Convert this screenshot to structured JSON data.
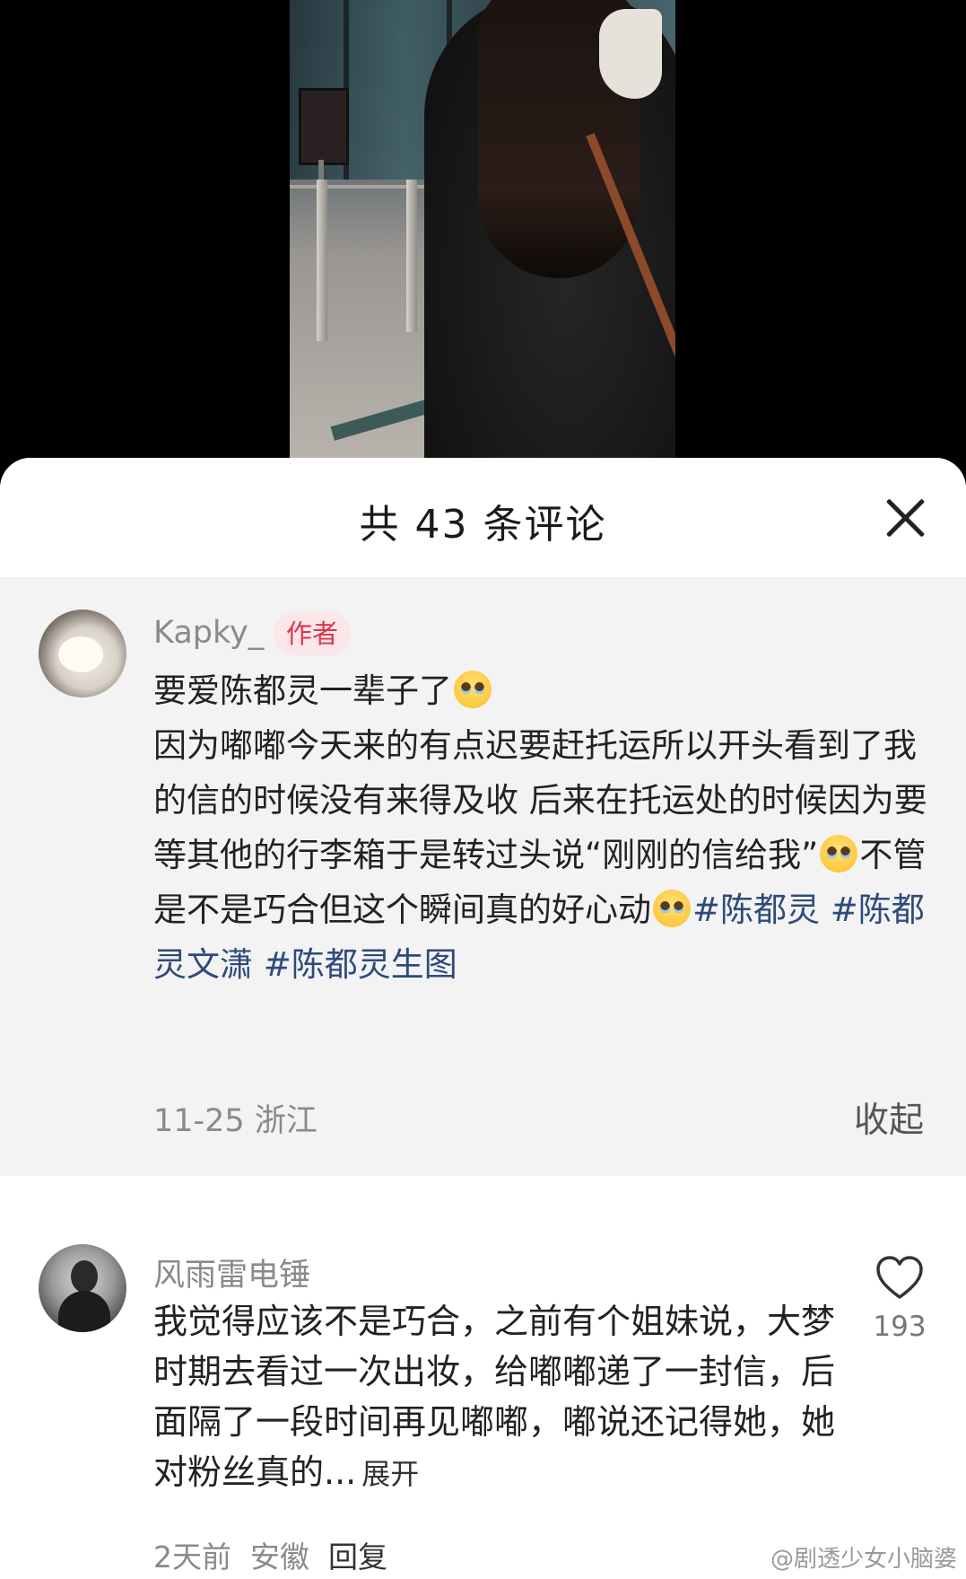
{
  "sheet": {
    "title": "共 43 条评论",
    "close_icon": "close-icon"
  },
  "pinned_comment": {
    "username": "Kapky_",
    "badge": "作者",
    "line1": "要爱陈都灵一辈子了",
    "body_a": "因为嘟嘟今天来的有点迟要赶托运所以开头看到了我的信的时候没有来得及收 后来在托运处的时候因为要等其他的行李箱于是转过头说“刚刚的信给我”",
    "body_b": "不管是不是巧合但这个瞬间真的好心动",
    "hashtags": [
      "#陈都灵",
      "#陈都灵文潇",
      "#陈都灵生图"
    ],
    "meta": "11-25 浙江",
    "collapse_label": "收起",
    "emoji_icon": "pleading-face-icon"
  },
  "comment2": {
    "username": "风雨雷电锤",
    "text": "我觉得应该不是巧合，之前有个姐妹说，大梦时期去看过一次出妆，给嘟嘟递了一封信，后面隔了一段时间再见嘟嘟，嘟说还记得她，她对粉丝真的...",
    "expand_label": "展开",
    "time": "2天前",
    "location": "安徽",
    "reply_label": "回复",
    "like_count": "193",
    "like_icon": "heart-outline-icon"
  },
  "watermark": "@剧透少女小脑婆",
  "colors": {
    "hashtag": "#2f4a7a",
    "badge_bg": "#fbe6ea",
    "badge_text": "#e0344a",
    "pinned_bg": "#f3f3f4"
  }
}
